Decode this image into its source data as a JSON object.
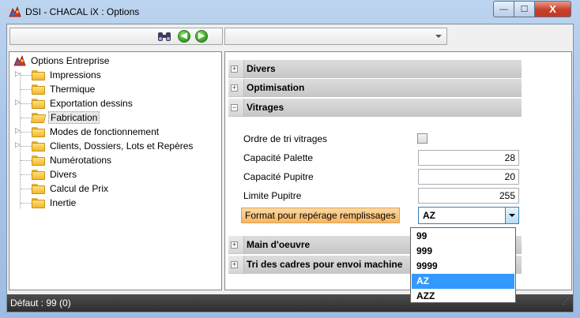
{
  "window": {
    "title": "DSI - CHACAL iX : Options",
    "minimize_icon": "minimize-icon",
    "maximize_icon": "maximize-icon",
    "close_icon": "close-icon",
    "minimize_glyph": "—",
    "maximize_glyph": "☐",
    "close_glyph": "X"
  },
  "toolbar": {
    "search_icon": "binoculars-icon",
    "back_icon": "back-arrow-icon",
    "forward_icon": "forward-arrow-icon",
    "back_glyph": "◀",
    "forward_glyph": "▶",
    "combo_value": ""
  },
  "tree": {
    "root": "Options Entreprise",
    "items": [
      {
        "label": "Impressions",
        "expandable": true
      },
      {
        "label": "Thermique",
        "expandable": false
      },
      {
        "label": "Exportation dessins",
        "expandable": true
      },
      {
        "label": "Fabrication",
        "expandable": false,
        "selected": true
      },
      {
        "label": "Modes de fonctionnement",
        "expandable": true
      },
      {
        "label": "Clients, Dossiers, Lots et Repères",
        "expandable": true
      },
      {
        "label": "Numérotations",
        "expandable": false
      },
      {
        "label": "Divers",
        "expandable": false
      },
      {
        "label": "Calcul de Prix",
        "expandable": false
      },
      {
        "label": "Inertie",
        "expandable": false
      }
    ]
  },
  "sections": {
    "divers": {
      "title": "Divers",
      "toggle": "+"
    },
    "optimisation": {
      "title": "Optimisation",
      "toggle": "+"
    },
    "vitrages": {
      "title": "Vitrages",
      "toggle": "−"
    },
    "main_oeuvre": {
      "title": "Main d'oeuvre",
      "toggle": "+"
    },
    "tri_cadres": {
      "title": "Tri des cadres pour envoi machine",
      "toggle": "+"
    }
  },
  "fields": {
    "ordre_tri": {
      "label": "Ordre de tri vitrages",
      "checked": false
    },
    "capacite_palette": {
      "label": "Capacité Palette",
      "value": "28"
    },
    "capacite_pupitre": {
      "label": "Capacité Pupitre",
      "value": "20"
    },
    "limite_pupitre": {
      "label": "Limite Pupitre",
      "value": "255"
    },
    "format_reperage": {
      "label": "Format pour repérage remplissages",
      "value": "AZ"
    }
  },
  "dropdown": {
    "options": [
      "99",
      "999",
      "9999",
      "AZ",
      "AZZ"
    ],
    "selected": "AZ"
  },
  "statusbar": {
    "text": "Défaut : 99 (0)"
  },
  "colors": {
    "selection": "#3399ff",
    "highlight_label": "#f6b662",
    "statusbar": "#3a3a3a"
  }
}
